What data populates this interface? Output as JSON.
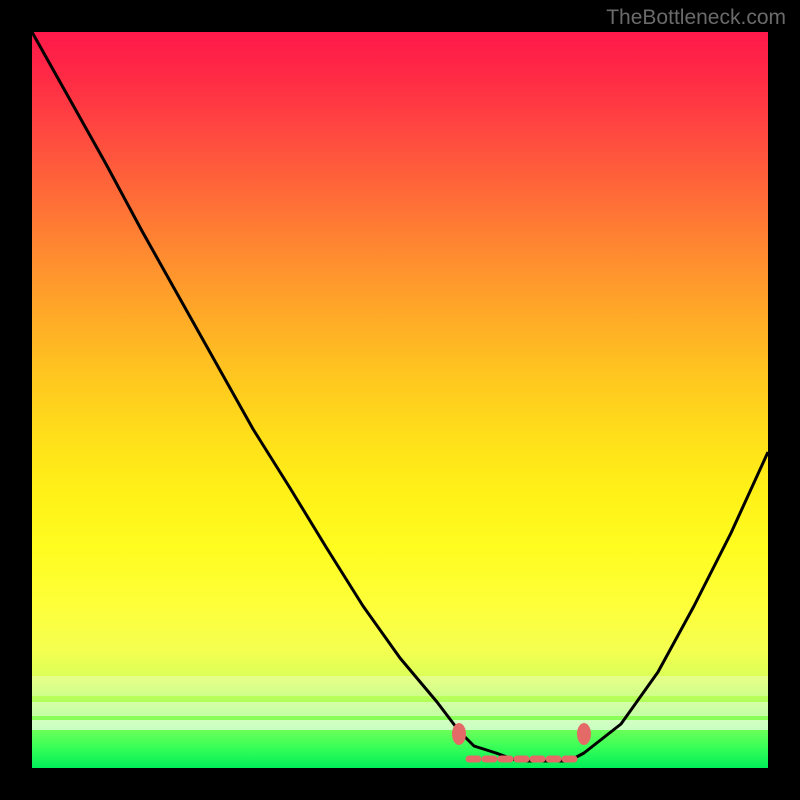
{
  "watermark": "TheBottleneck.com",
  "chart_data": {
    "type": "line",
    "title": "",
    "xlabel": "",
    "ylabel": "",
    "xlim": [
      0,
      100
    ],
    "ylim": [
      0,
      100
    ],
    "grid": false,
    "series": [
      {
        "name": "bottleneck-curve",
        "x": [
          0,
          5,
          10,
          15,
          20,
          25,
          30,
          35,
          40,
          45,
          50,
          55,
          58,
          60,
          63,
          66,
          70,
          73,
          75,
          80,
          85,
          90,
          95,
          100
        ],
        "y": [
          100,
          91,
          82,
          73,
          64,
          55,
          46,
          38,
          30,
          22,
          15,
          9,
          5,
          3,
          2,
          1,
          1,
          1,
          2,
          6,
          13,
          22,
          32,
          43
        ]
      }
    ],
    "markers": [
      {
        "name": "range-start-dot",
        "x": 58,
        "y": 5
      },
      {
        "name": "range-end-dot",
        "x": 75,
        "y": 5
      }
    ],
    "range_band": {
      "from_x": 60,
      "to_x": 73,
      "y": 1
    },
    "background_gradient": {
      "stops": [
        {
          "pos": 0,
          "color": "#ff194a"
        },
        {
          "pos": 50,
          "color": "#ffdc1a"
        },
        {
          "pos": 100,
          "color": "#00ef59"
        }
      ]
    }
  }
}
